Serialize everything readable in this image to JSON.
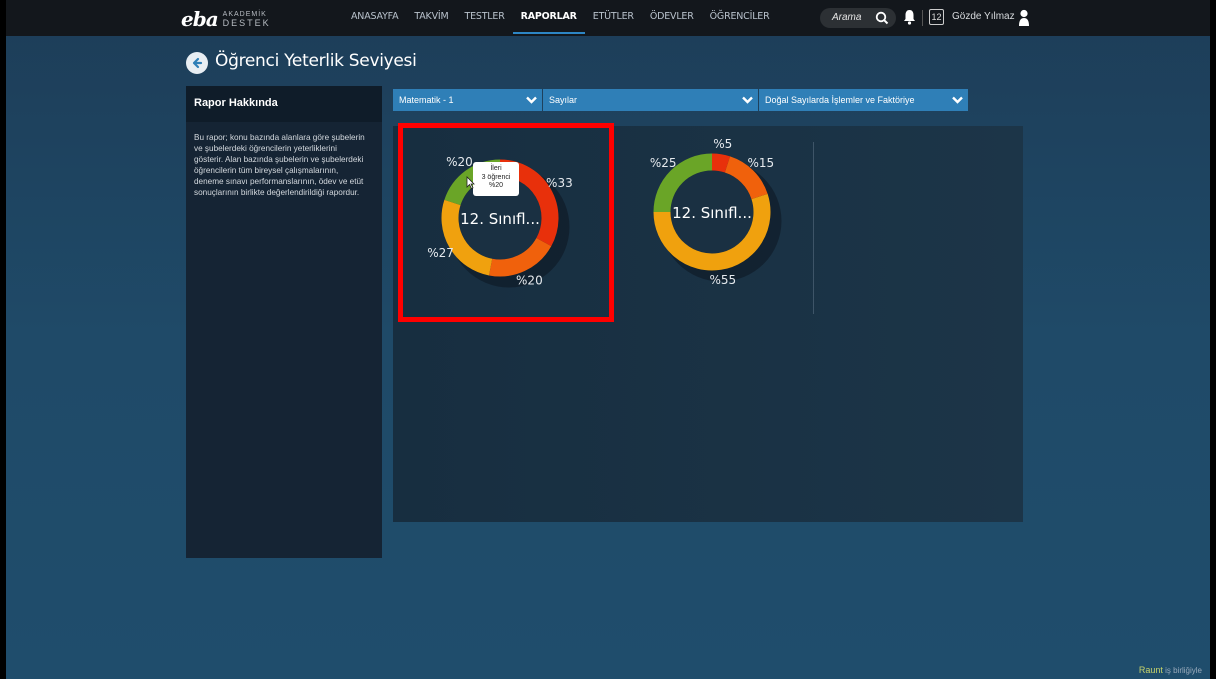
{
  "navbar": {
    "logo_main": "eba",
    "logo_sub_1": "AKADEMİK",
    "logo_sub_2": "DESTEK",
    "items": [
      {
        "label": "ANASAYFA",
        "active": false
      },
      {
        "label": "TAKVİM",
        "active": false
      },
      {
        "label": "TESTLER",
        "active": false
      },
      {
        "label": "RAPORLAR",
        "active": true
      },
      {
        "label": "ETÜTLER",
        "active": false
      },
      {
        "label": "ÖDEVLER",
        "active": false
      },
      {
        "label": "ÖĞRENCİLER",
        "active": false
      }
    ],
    "search_placeholder": "Arama",
    "calendar_day": "12",
    "username": "Gözde Yılmaz"
  },
  "page": {
    "title": "Öğrenci Yeterlik Seviyesi"
  },
  "about": {
    "header": "Rapor Hakkında",
    "text": "Bu rapor; konu bazında alanlara göre şubelerin ve şubelerdeki öğrencilerin yeterliklerini gösterir. Alan bazında şubelerin ve şubelerdeki öğrencilerin tüm bireysel çalışmalarının, deneme sınavı performanslarının, ödev ve etüt sonuçlarının birlikte değerlendirildiği rapordur."
  },
  "filters": {
    "subject": "Matematik - 1",
    "unit": "Sayılar",
    "topic": "Doğal Sayılarda İşlemler ve Faktöriye"
  },
  "colors": {
    "green": "#6aa527",
    "red": "#e8300b",
    "orange": "#f0610c",
    "yellow": "#f0a10e",
    "accent": "#2f7fb7"
  },
  "chart_data": [
    {
      "type": "pie",
      "center_label": "12. Sınıfl...",
      "slices": [
        {
          "label": "%20",
          "value": 20,
          "color": "#6aa527"
        },
        {
          "label": "%33",
          "value": 33,
          "color": "#e8300b"
        },
        {
          "label": "%20",
          "value": 20,
          "color": "#f0610c"
        },
        {
          "label": "%27",
          "value": 27,
          "color": "#f0a10e"
        }
      ],
      "tooltip": {
        "line1": "İleri",
        "line2": "3 öğrenci",
        "line3": "%20"
      }
    },
    {
      "type": "pie",
      "center_label": "12. Sınıfl...",
      "slices": [
        {
          "label": "%5",
          "value": 5,
          "color": "#e8300b"
        },
        {
          "label": "%15",
          "value": 15,
          "color": "#f0610c"
        },
        {
          "label": "%55",
          "value": 55,
          "color": "#f0a10e"
        },
        {
          "label": "%25",
          "value": 25,
          "color": "#6aa527"
        }
      ]
    }
  ],
  "watermark": {
    "brand": "Raunt",
    "suffix": "iş birliğiyle"
  }
}
